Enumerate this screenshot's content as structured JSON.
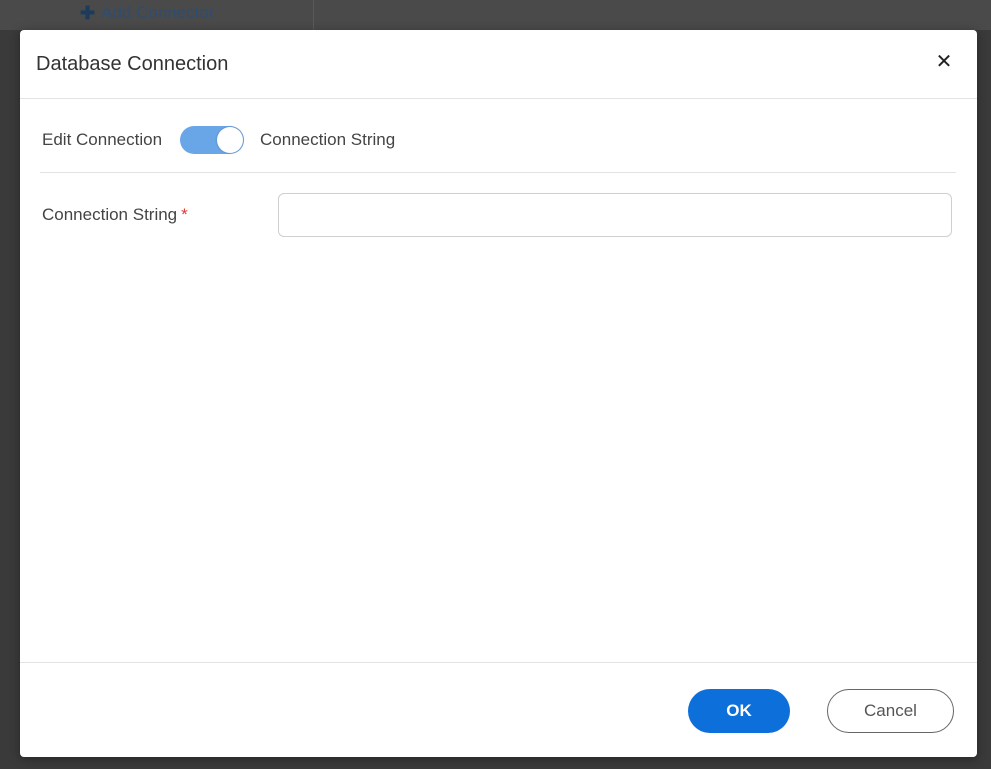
{
  "background": {
    "add_connector_label": "Add Connector"
  },
  "dialog": {
    "title": "Database Connection",
    "close_icon": "close-icon",
    "mode": {
      "left_label": "Edit Connection",
      "right_label": "Connection String",
      "toggle_on": true
    },
    "field": {
      "label": "Connection String",
      "required_mark": "*",
      "value": "",
      "placeholder": ""
    },
    "buttons": {
      "ok_label": "OK",
      "cancel_label": "Cancel"
    }
  },
  "colors": {
    "accent": "#0d6fd9",
    "toggle": "#69a6e8",
    "required": "#e53935"
  }
}
